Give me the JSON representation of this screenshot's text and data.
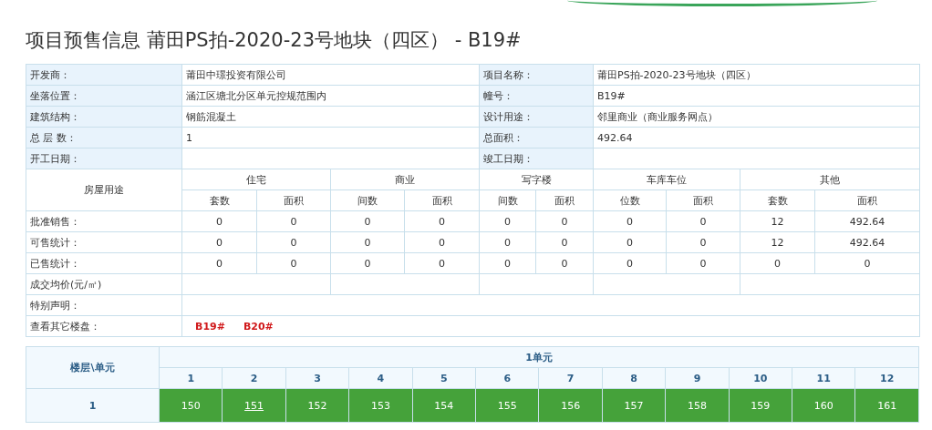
{
  "title": "项目预售信息 莆田PS拍-2020-23号地块（四区） - B19#",
  "info_rows": [
    {
      "cells": [
        {
          "label": "开发商：",
          "value": "莆田中璟投资有限公司"
        },
        {
          "label": "项目名称：",
          "value": "莆田PS拍-2020-23号地块（四区）"
        }
      ]
    },
    {
      "cells": [
        {
          "label": "坐落位置：",
          "value": "涵江区塘北分区单元控规范围内"
        },
        {
          "label": "幢号：",
          "value": "B19#"
        }
      ]
    },
    {
      "cells": [
        {
          "label": "建筑结构：",
          "value": "钢筋混凝土"
        },
        {
          "label": "设计用途：",
          "value": "邻里商业（商业服务网点）"
        }
      ]
    },
    {
      "cells": [
        {
          "label": "总 层 数：",
          "value": "1"
        },
        {
          "label": "总面积：",
          "value": "492.64"
        }
      ]
    },
    {
      "cells": [
        {
          "label": "开工日期："
        },
        {
          "label": "竣工日期："
        }
      ]
    }
  ],
  "usage": {
    "header": "房屋用途",
    "categories": [
      {
        "name": "住宅",
        "columns": [
          "套数",
          "面积"
        ]
      },
      {
        "name": "商业",
        "columns": [
          "间数",
          "面积"
        ]
      },
      {
        "name": "写字楼",
        "columns": [
          "间数",
          "面积"
        ]
      },
      {
        "name": "车库车位",
        "columns": [
          "位数",
          "面积"
        ]
      },
      {
        "name": "其他",
        "columns": [
          "套数",
          "面积"
        ]
      }
    ],
    "rows": [
      {
        "label": "批准销售：",
        "values": [
          "0",
          "0",
          "0",
          "0",
          "0",
          "0",
          "0",
          "0",
          "12",
          "492.64"
        ]
      },
      {
        "label": "可售统计：",
        "values": [
          "0",
          "0",
          "0",
          "0",
          "0",
          "0",
          "0",
          "0",
          "12",
          "492.64"
        ]
      },
      {
        "label": "已售统计：",
        "values": [
          "0",
          "0",
          "0",
          "0",
          "0",
          "0",
          "0",
          "0",
          "0",
          "0"
        ]
      }
    ],
    "price_label": "成交均价(元/㎡)",
    "note_label": "特别声明：",
    "other_buildings": {
      "label": "查看其它楼盘：",
      "links": [
        "B19#",
        "B20#"
      ]
    }
  },
  "unit_grid": {
    "corner": "楼层\\单元",
    "unit": "1单元",
    "rooms": [
      "1",
      "2",
      "3",
      "4",
      "5",
      "6",
      "7",
      "8",
      "9",
      "10",
      "11",
      "12"
    ],
    "floors": [
      {
        "floor": "1",
        "cells": [
          {
            "number": "150",
            "underlined": false,
            "color": "#45a23a"
          },
          {
            "number": "151",
            "underlined": true,
            "color": "#45a23a"
          },
          {
            "number": "152",
            "underlined": false,
            "color": "#45a23a"
          },
          {
            "number": "153",
            "underlined": false,
            "color": "#45a23a"
          },
          {
            "number": "154",
            "underlined": false,
            "color": "#45a23a"
          },
          {
            "number": "155",
            "underlined": false,
            "color": "#45a23a"
          },
          {
            "number": "156",
            "underlined": false,
            "color": "#45a23a"
          },
          {
            "number": "157",
            "underlined": false,
            "color": "#45a23a"
          },
          {
            "number": "158",
            "underlined": false,
            "color": "#45a23a"
          },
          {
            "number": "159",
            "underlined": false,
            "color": "#45a23a"
          },
          {
            "number": "160",
            "underlined": false,
            "color": "#45a23a"
          },
          {
            "number": "161",
            "underlined": false,
            "color": "#45a23a"
          }
        ]
      }
    ]
  }
}
